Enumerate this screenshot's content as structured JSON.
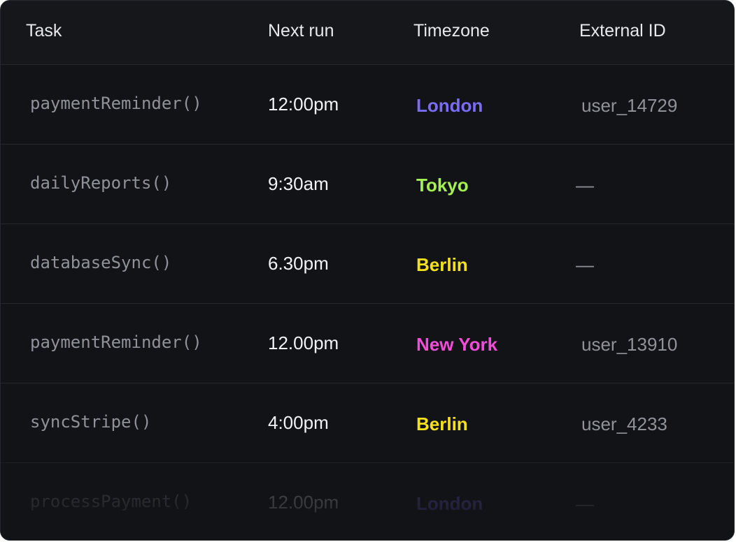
{
  "table": {
    "columns": {
      "task": "Task",
      "next_run": "Next run",
      "timezone": "Timezone",
      "external_id": "External ID"
    },
    "rows": [
      {
        "task": "paymentReminder()",
        "next_run": "12:00pm",
        "timezone": "London",
        "timezone_color": "#7b6cf6",
        "external_id": "user_14729"
      },
      {
        "task": "dailyReports()",
        "next_run": "9:30am",
        "timezone": "Tokyo",
        "timezone_color": "#a6ef52",
        "external_id": "—"
      },
      {
        "task": "databaseSync()",
        "next_run": "6.30pm",
        "timezone": "Berlin",
        "timezone_color": "#f5e11b",
        "external_id": "—"
      },
      {
        "task": "paymentReminder()",
        "next_run": "12.00pm",
        "timezone": "New York",
        "timezone_color": "#f44cd9",
        "external_id": "user_13910"
      },
      {
        "task": "syncStripe()",
        "next_run": "4:00pm",
        "timezone": "Berlin",
        "timezone_color": "#f5e11b",
        "external_id": "user_4233"
      },
      {
        "task": "processPayment()",
        "next_run": "12.00pm",
        "timezone": "London",
        "timezone_color": "#7b6cf6",
        "external_id": "—"
      }
    ]
  }
}
